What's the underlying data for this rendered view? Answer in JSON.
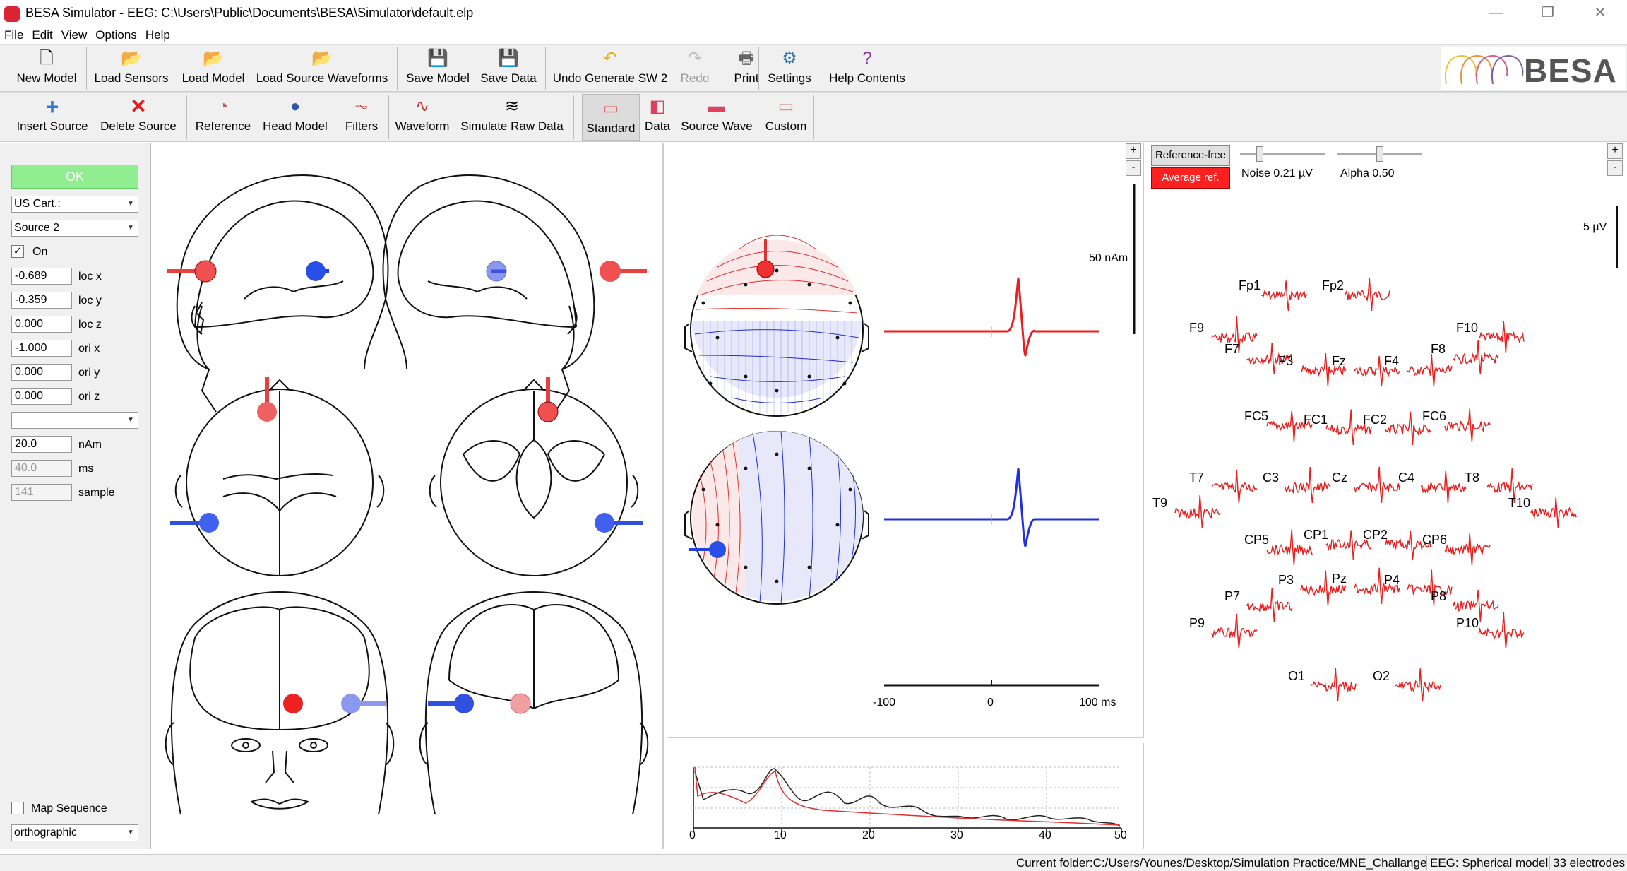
{
  "window": {
    "title": "BESA Simulator - EEG: C:\\Users\\Public\\Documents\\BESA\\Simulator\\default.elp"
  },
  "menu": [
    "File",
    "Edit",
    "View",
    "Options",
    "Help"
  ],
  "toolbar1": {
    "new_model": "New Model",
    "load_sensors": "Load Sensors",
    "load_model": "Load Model",
    "load_source_waveforms": "Load Source Waveforms",
    "save_model": "Save Model",
    "save_data": "Save Data",
    "undo": "Undo Generate SW 2",
    "redo": "Redo",
    "print": "Print",
    "settings": "Settings",
    "help_contents": "Help Contents"
  },
  "brand": {
    "logo_text": "BESA"
  },
  "toolbar2": {
    "insert_source": "Insert Source",
    "delete_source": "Delete Source",
    "reference": "Reference",
    "head_model": "Head Model",
    "filters": "Filters",
    "waveform": "Waveform",
    "simulate_raw_data": "Simulate Raw Data",
    "standard": "Standard",
    "data": "Data",
    "source_wave": "Source Wave",
    "custom": "Custom"
  },
  "left_panel": {
    "ok": "OK",
    "coord_system": "US Cart.:",
    "source": "Source 2",
    "on_label": "On",
    "on_checked": "✓",
    "loc_x": "-0.689",
    "loc_x_label": "loc x",
    "loc_y": "-0.359",
    "loc_y_label": "loc y",
    "loc_z": "0.000",
    "loc_z_label": "loc z",
    "ori_x": "-1.000",
    "ori_x_label": "ori x",
    "ori_y": "0.000",
    "ori_y_label": "ori y",
    "ori_z": "0.000",
    "ori_z_label": "ori z",
    "empty_select": "",
    "amplitude": "20.0",
    "amplitude_unit": "nAm",
    "latency": "40.0",
    "latency_unit": "ms",
    "sample": "141",
    "sample_unit": "sample",
    "map_sequence": "Map Sequence",
    "projection": "orthographic"
  },
  "waveform_panel": {
    "scale_label": "50 nAm",
    "x_ticks": [
      "-100",
      "0",
      "100 ms"
    ],
    "plus": "+",
    "minus": "-"
  },
  "spectrum": {
    "x_ticks": [
      "0",
      "10",
      "20",
      "30",
      "40",
      "50"
    ],
    "colors": {
      "black": "#222222",
      "red": "#e03030"
    }
  },
  "eeg_panel": {
    "reference_free": "Reference-free",
    "average_ref": "Average ref.",
    "noise": "Noise 0.21 µV",
    "alpha": "Alpha 0.50",
    "noise_level": 0.21,
    "alpha_level": 0.5,
    "scale": "5 µV",
    "plus": "+",
    "minus": "-",
    "electrodes": [
      "Fp1",
      "Fp2",
      "F9",
      "F10",
      "F7",
      "F3",
      "Fz",
      "F4",
      "F8",
      "FC5",
      "FC1",
      "FC2",
      "FC6",
      "T7",
      "C3",
      "Cz",
      "C4",
      "T8",
      "T9",
      "T10",
      "CP5",
      "CP1",
      "CP2",
      "CP6",
      "P7",
      "P3",
      "Pz",
      "P4",
      "P8",
      "P9",
      "P10",
      "O1",
      "O2"
    ]
  },
  "statusbar": {
    "folder": "Current folder:C:/Users/Younes/Desktop/Simulation Practice/MNE_Challange",
    "model": "EEG: Spherical model",
    "electrodes": "33 electrodes"
  },
  "colors": {
    "red_source": "#e83030",
    "blue_source": "#2040e0",
    "ok_green": "#90ee90",
    "avg_ref_red": "#ff2020"
  }
}
